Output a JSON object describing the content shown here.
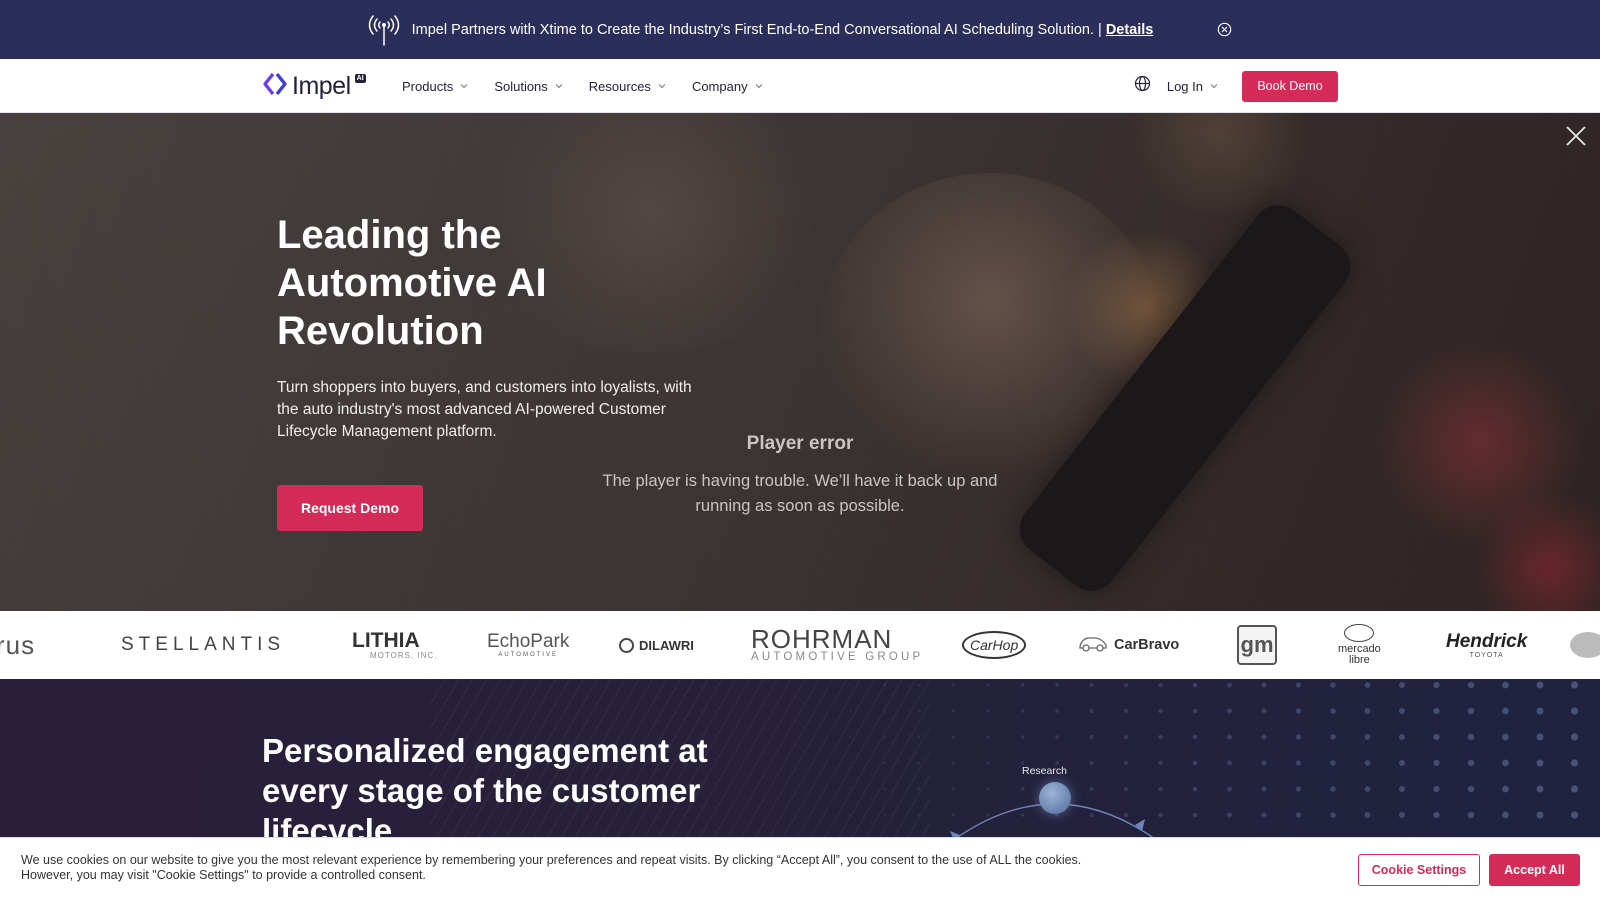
{
  "announcement": {
    "text": "Impel Partners with Xtime to Create the Industry’s First End-to-End Conversational AI Scheduling Solution. |",
    "link_label": "Details"
  },
  "nav": {
    "logo_text": "Impel",
    "logo_badge": "AI",
    "menu": [
      {
        "label": "Products"
      },
      {
        "label": "Solutions"
      },
      {
        "label": "Resources"
      },
      {
        "label": "Company"
      }
    ],
    "login_label": "Log In",
    "book_demo_label": "Book Demo"
  },
  "hero": {
    "title": "Leading the Automotive AI Revolution",
    "subtitle": "Turn shoppers into buyers, and customers into loyalists, with the auto industry's most advanced AI-powered Customer Lifecycle Management platform.",
    "cta_label": "Request Demo",
    "player_error_title": "Player error",
    "player_error_message": "The player is having trouble. We’ll have it back up and running as soon as possible."
  },
  "partner_logos": [
    {
      "name": "rus"
    },
    {
      "name": "STELLANTIS"
    },
    {
      "name": "LITHIA",
      "sub": "MOTORS, INC."
    },
    {
      "name": "EchoPark",
      "sub": "AUTOMOTIVE"
    },
    {
      "name": "DILAWRI"
    },
    {
      "name": "ROHRMAN",
      "sub": "AUTOMOTIVE GROUP"
    },
    {
      "name": "CarHop"
    },
    {
      "name": "CarBravo"
    },
    {
      "name": "gm"
    },
    {
      "name": "mercado",
      "sub": "libre"
    },
    {
      "name": "Hendrick",
      "sub": "TOYOTA"
    }
  ],
  "lower": {
    "heading": "Personalized engagement at every stage of the customer lifecycle",
    "research_label": "Research"
  },
  "cookie": {
    "message": "We use cookies on our website to give you the most relevant experience by remembering your preferences and repeat visits. By clicking “Accept All”, you consent to the use of ALL the cookies. However, you may visit \"Cookie Settings\" to provide a controlled consent.",
    "settings_label": "Cookie Settings",
    "accept_label": "Accept All"
  },
  "colors": {
    "accent": "#d42b58",
    "announcement_bg": "#2c2e5a",
    "nav_text": "#23233b",
    "brand_purple": "#5b3df0"
  },
  "icons": [
    "broadcast-tower-icon",
    "circle-close-icon",
    "logo-mark-icon",
    "chevron-down-icon",
    "globe-icon",
    "close-icon"
  ]
}
